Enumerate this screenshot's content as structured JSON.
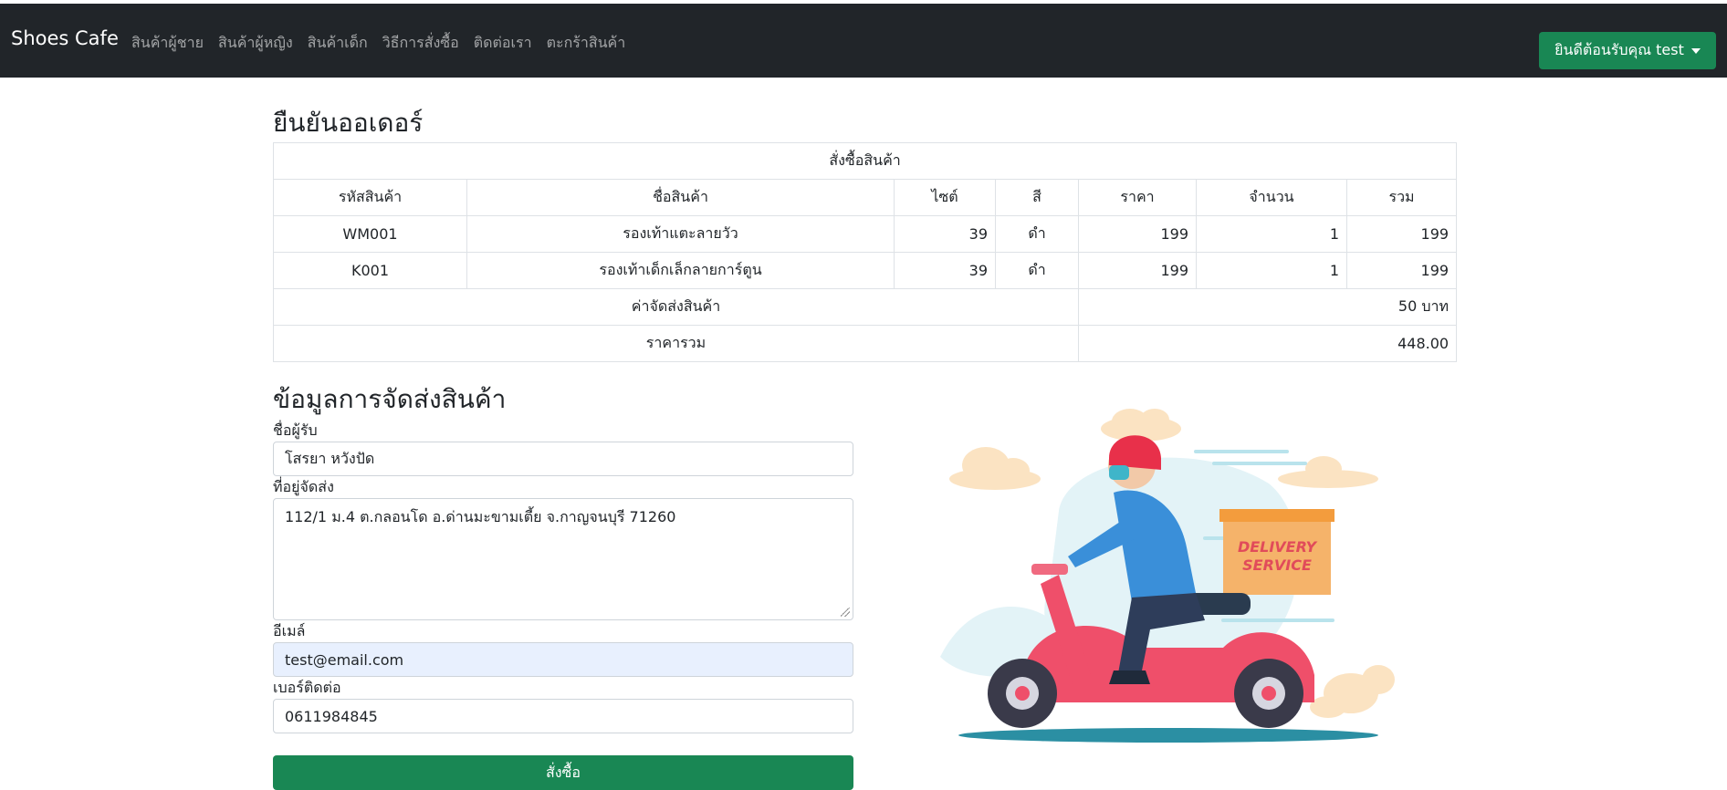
{
  "navbar": {
    "brand": "Shoes Cafe",
    "links": [
      "สินค้าผู้ชาย",
      "สินค้าผู้หญิง",
      "สินค้าเด็ก",
      "วิธีการสั่งซื้อ",
      "ติดต่อเรา",
      "ตะกร้าสินค้า"
    ],
    "user_button": "ยินดีต้อนรับคุณ test"
  },
  "page_title": "ยืนยันออเดอร์",
  "order_table": {
    "caption": "สั่งซื้อสินค้า",
    "headers": [
      "รหัสสินค้า",
      "ชื่อสินค้า",
      "ไซต์",
      "สี",
      "ราคา",
      "จำนวน",
      "รวม"
    ],
    "rows": [
      [
        "WM001",
        "รองเท้าแตะลายวัว",
        "39",
        "ดำ",
        "199",
        "1",
        "199"
      ],
      [
        "K001",
        "รองเท้าเด็กเล็กลายการ์ตูน",
        "39",
        "ดำ",
        "199",
        "1",
        "199"
      ]
    ],
    "shipping_label": "ค่าจัดส่งสินค้า",
    "shipping_value": "50 บาท",
    "total_label": "ราคารวม",
    "total_value": "448.00"
  },
  "shipping_section": {
    "title": "ข้อมูลการจัดส่งสินค้า",
    "name_label": "ชื่อผู้รับ",
    "name_value": "โสรยา หวังปัด",
    "address_label": "ที่อยู่จัดส่ง",
    "address_value": "112/1 ม.4 ต.กลอนโด อ.ด่านมะขามเตี้ย จ.กาญจนบุรี 71260",
    "email_label": "อีเมล์",
    "email_value": "test@email.com",
    "phone_label": "เบอร์ติดต่อ",
    "phone_value": "0611984845",
    "submit_label": "สั่งซื้อ"
  },
  "illustration": {
    "box_text_line1": "DELIVERY",
    "box_text_line2": "SERVICE"
  },
  "colors": {
    "navbar": "#212529",
    "success": "#198754",
    "autofill": "#e8f0fe"
  }
}
